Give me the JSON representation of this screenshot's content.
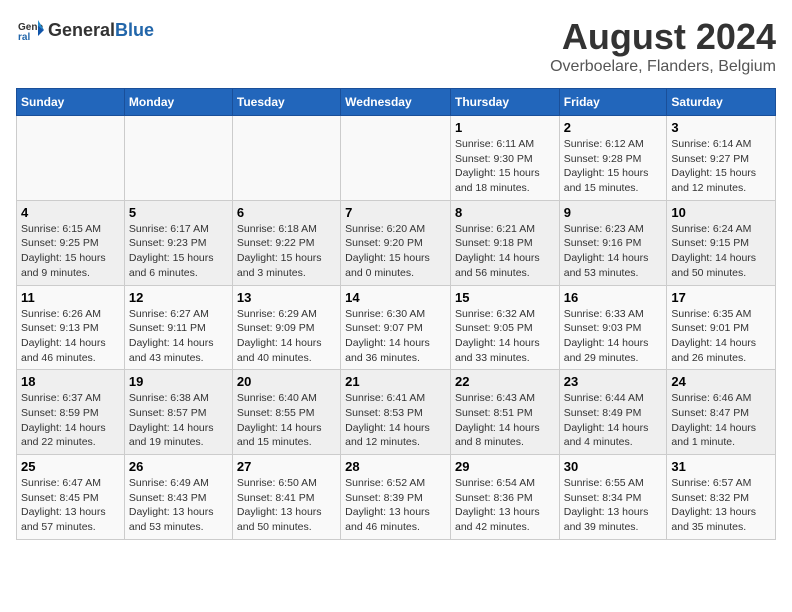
{
  "header": {
    "logo_general": "General",
    "logo_blue": "Blue",
    "main_title": "August 2024",
    "subtitle": "Overboelare, Flanders, Belgium"
  },
  "days_of_week": [
    "Sunday",
    "Monday",
    "Tuesday",
    "Wednesday",
    "Thursday",
    "Friday",
    "Saturday"
  ],
  "weeks": [
    [
      {
        "day": "",
        "info": ""
      },
      {
        "day": "",
        "info": ""
      },
      {
        "day": "",
        "info": ""
      },
      {
        "day": "",
        "info": ""
      },
      {
        "day": "1",
        "info": "Sunrise: 6:11 AM\nSunset: 9:30 PM\nDaylight: 15 hours\nand 18 minutes."
      },
      {
        "day": "2",
        "info": "Sunrise: 6:12 AM\nSunset: 9:28 PM\nDaylight: 15 hours\nand 15 minutes."
      },
      {
        "day": "3",
        "info": "Sunrise: 6:14 AM\nSunset: 9:27 PM\nDaylight: 15 hours\nand 12 minutes."
      }
    ],
    [
      {
        "day": "4",
        "info": "Sunrise: 6:15 AM\nSunset: 9:25 PM\nDaylight: 15 hours\nand 9 minutes."
      },
      {
        "day": "5",
        "info": "Sunrise: 6:17 AM\nSunset: 9:23 PM\nDaylight: 15 hours\nand 6 minutes."
      },
      {
        "day": "6",
        "info": "Sunrise: 6:18 AM\nSunset: 9:22 PM\nDaylight: 15 hours\nand 3 minutes."
      },
      {
        "day": "7",
        "info": "Sunrise: 6:20 AM\nSunset: 9:20 PM\nDaylight: 15 hours\nand 0 minutes."
      },
      {
        "day": "8",
        "info": "Sunrise: 6:21 AM\nSunset: 9:18 PM\nDaylight: 14 hours\nand 56 minutes."
      },
      {
        "day": "9",
        "info": "Sunrise: 6:23 AM\nSunset: 9:16 PM\nDaylight: 14 hours\nand 53 minutes."
      },
      {
        "day": "10",
        "info": "Sunrise: 6:24 AM\nSunset: 9:15 PM\nDaylight: 14 hours\nand 50 minutes."
      }
    ],
    [
      {
        "day": "11",
        "info": "Sunrise: 6:26 AM\nSunset: 9:13 PM\nDaylight: 14 hours\nand 46 minutes."
      },
      {
        "day": "12",
        "info": "Sunrise: 6:27 AM\nSunset: 9:11 PM\nDaylight: 14 hours\nand 43 minutes."
      },
      {
        "day": "13",
        "info": "Sunrise: 6:29 AM\nSunset: 9:09 PM\nDaylight: 14 hours\nand 40 minutes."
      },
      {
        "day": "14",
        "info": "Sunrise: 6:30 AM\nSunset: 9:07 PM\nDaylight: 14 hours\nand 36 minutes."
      },
      {
        "day": "15",
        "info": "Sunrise: 6:32 AM\nSunset: 9:05 PM\nDaylight: 14 hours\nand 33 minutes."
      },
      {
        "day": "16",
        "info": "Sunrise: 6:33 AM\nSunset: 9:03 PM\nDaylight: 14 hours\nand 29 minutes."
      },
      {
        "day": "17",
        "info": "Sunrise: 6:35 AM\nSunset: 9:01 PM\nDaylight: 14 hours\nand 26 minutes."
      }
    ],
    [
      {
        "day": "18",
        "info": "Sunrise: 6:37 AM\nSunset: 8:59 PM\nDaylight: 14 hours\nand 22 minutes."
      },
      {
        "day": "19",
        "info": "Sunrise: 6:38 AM\nSunset: 8:57 PM\nDaylight: 14 hours\nand 19 minutes."
      },
      {
        "day": "20",
        "info": "Sunrise: 6:40 AM\nSunset: 8:55 PM\nDaylight: 14 hours\nand 15 minutes."
      },
      {
        "day": "21",
        "info": "Sunrise: 6:41 AM\nSunset: 8:53 PM\nDaylight: 14 hours\nand 12 minutes."
      },
      {
        "day": "22",
        "info": "Sunrise: 6:43 AM\nSunset: 8:51 PM\nDaylight: 14 hours\nand 8 minutes."
      },
      {
        "day": "23",
        "info": "Sunrise: 6:44 AM\nSunset: 8:49 PM\nDaylight: 14 hours\nand 4 minutes."
      },
      {
        "day": "24",
        "info": "Sunrise: 6:46 AM\nSunset: 8:47 PM\nDaylight: 14 hours\nand 1 minute."
      }
    ],
    [
      {
        "day": "25",
        "info": "Sunrise: 6:47 AM\nSunset: 8:45 PM\nDaylight: 13 hours\nand 57 minutes."
      },
      {
        "day": "26",
        "info": "Sunrise: 6:49 AM\nSunset: 8:43 PM\nDaylight: 13 hours\nand 53 minutes."
      },
      {
        "day": "27",
        "info": "Sunrise: 6:50 AM\nSunset: 8:41 PM\nDaylight: 13 hours\nand 50 minutes."
      },
      {
        "day": "28",
        "info": "Sunrise: 6:52 AM\nSunset: 8:39 PM\nDaylight: 13 hours\nand 46 minutes."
      },
      {
        "day": "29",
        "info": "Sunrise: 6:54 AM\nSunset: 8:36 PM\nDaylight: 13 hours\nand 42 minutes."
      },
      {
        "day": "30",
        "info": "Sunrise: 6:55 AM\nSunset: 8:34 PM\nDaylight: 13 hours\nand 39 minutes."
      },
      {
        "day": "31",
        "info": "Sunrise: 6:57 AM\nSunset: 8:32 PM\nDaylight: 13 hours\nand 35 minutes."
      }
    ]
  ]
}
